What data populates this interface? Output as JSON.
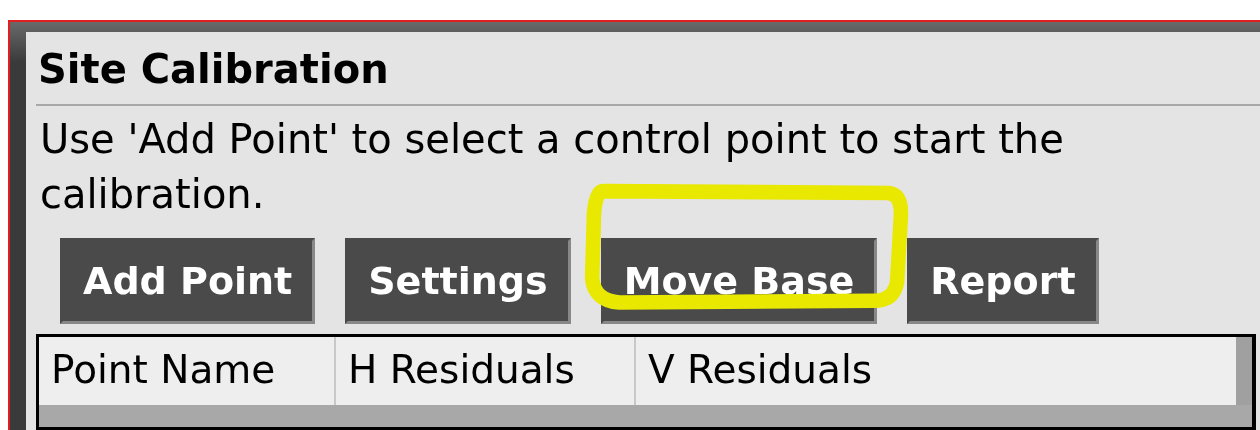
{
  "panel": {
    "title": "Site Calibration",
    "message": "Use 'Add Point' to select a control point to start the calibration."
  },
  "buttons": [
    {
      "label": "Add Point",
      "highlighted": false
    },
    {
      "label": "Settings",
      "highlighted": false
    },
    {
      "label": "Move Base",
      "highlighted": true
    },
    {
      "label": "Report",
      "highlighted": false
    }
  ],
  "table": {
    "columns": [
      "Point Name",
      "H Residuals",
      "V Residuals"
    ]
  }
}
